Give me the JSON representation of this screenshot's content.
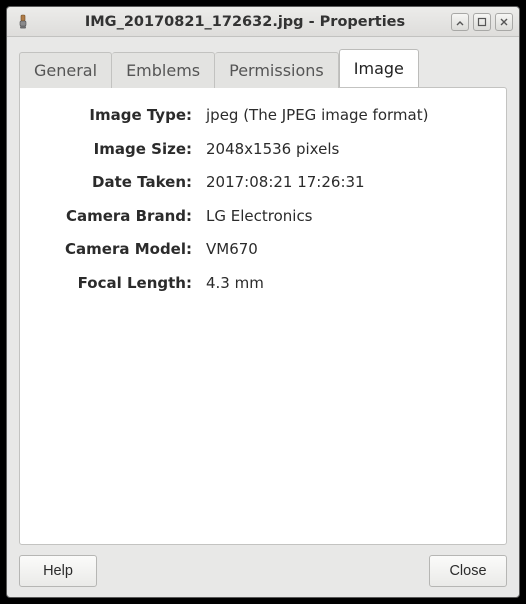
{
  "window": {
    "title": "IMG_20170821_172632.jpg - Properties"
  },
  "tabs": {
    "general": "General",
    "emblems": "Emblems",
    "permissions": "Permissions",
    "image": "Image",
    "active": "image"
  },
  "props": {
    "image_type": {
      "label": "Image Type:",
      "value": "jpeg (The JPEG image format)"
    },
    "image_size": {
      "label": "Image Size:",
      "value": "2048x1536 pixels"
    },
    "date_taken": {
      "label": "Date Taken:",
      "value": "2017:08:21 17:26:31"
    },
    "camera_brand": {
      "label": "Camera Brand:",
      "value": "LG Electronics"
    },
    "camera_model": {
      "label": "Camera Model:",
      "value": "VM670"
    },
    "focal_length": {
      "label": "Focal Length:",
      "value": "4.3 mm"
    }
  },
  "footer": {
    "help": "Help",
    "close": "Close"
  }
}
